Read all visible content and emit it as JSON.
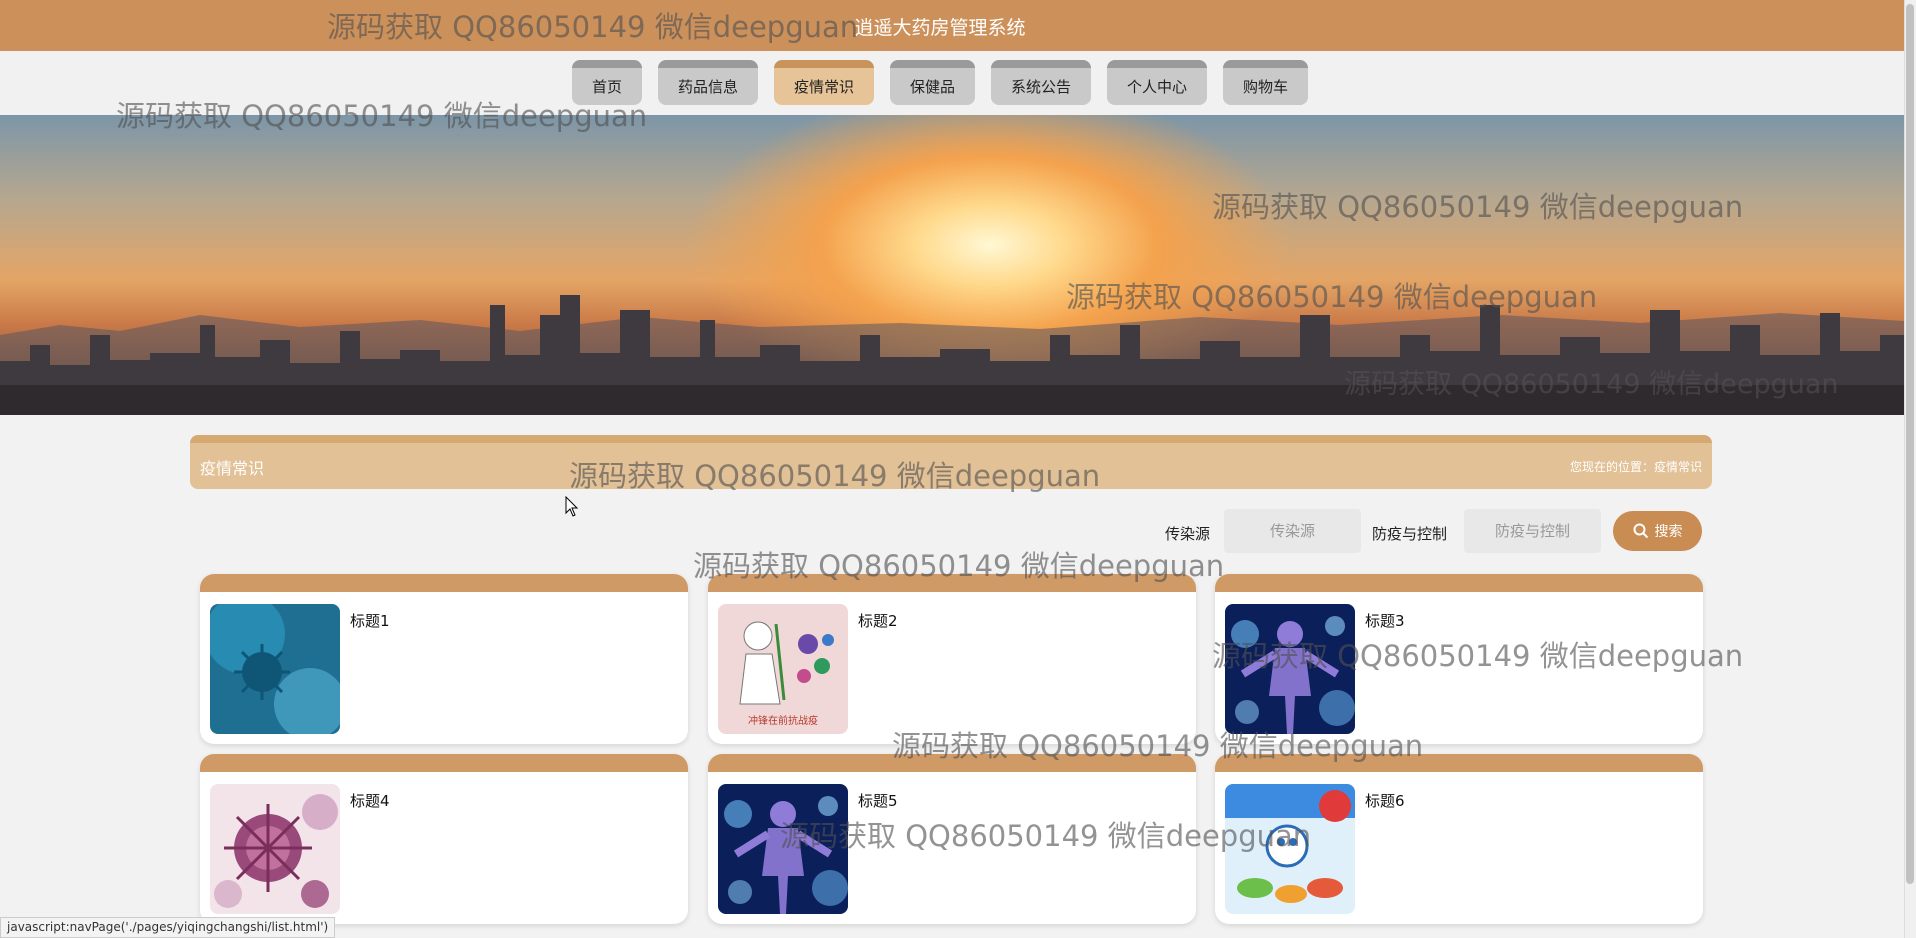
{
  "header": {
    "title": "逍遥大药房管理系统"
  },
  "nav": {
    "items": [
      {
        "label": "首页",
        "active": false
      },
      {
        "label": "药品信息",
        "active": false
      },
      {
        "label": "疫情常识",
        "active": true
      },
      {
        "label": "保健品",
        "active": false
      },
      {
        "label": "系统公告",
        "active": false
      },
      {
        "label": "个人中心",
        "active": false
      },
      {
        "label": "购物车",
        "active": false
      }
    ]
  },
  "section": {
    "title": "疫情常识",
    "breadcrumb": "您现在的位置：疫情常识"
  },
  "search": {
    "field1_label": "传染源",
    "field1_placeholder": "传染源",
    "field2_label": "防疫与控制",
    "field2_placeholder": "防疫与控制",
    "button_label": "搜索"
  },
  "cards": [
    {
      "title": "标题1",
      "image": "virus-blue"
    },
    {
      "title": "标题2",
      "image": "doctor-cartoon",
      "image_caption": "冲锋在前抗战疫"
    },
    {
      "title": "标题3",
      "image": "human-virus"
    },
    {
      "title": "标题4",
      "image": "virus-pink"
    },
    {
      "title": "标题5",
      "image": "human-virus"
    },
    {
      "title": "标题6",
      "image": "food-cartoon"
    }
  ],
  "watermark": "源码获取 QQ86050149 微信deepguan",
  "status_bar": "javascript:navPage('./pages/yiqingchangshi/list.html')",
  "colors": {
    "accent": "#cc915b",
    "active_tab": "#e6c497",
    "section_bar": "#e2c196",
    "card_top": "#cf9a66"
  }
}
